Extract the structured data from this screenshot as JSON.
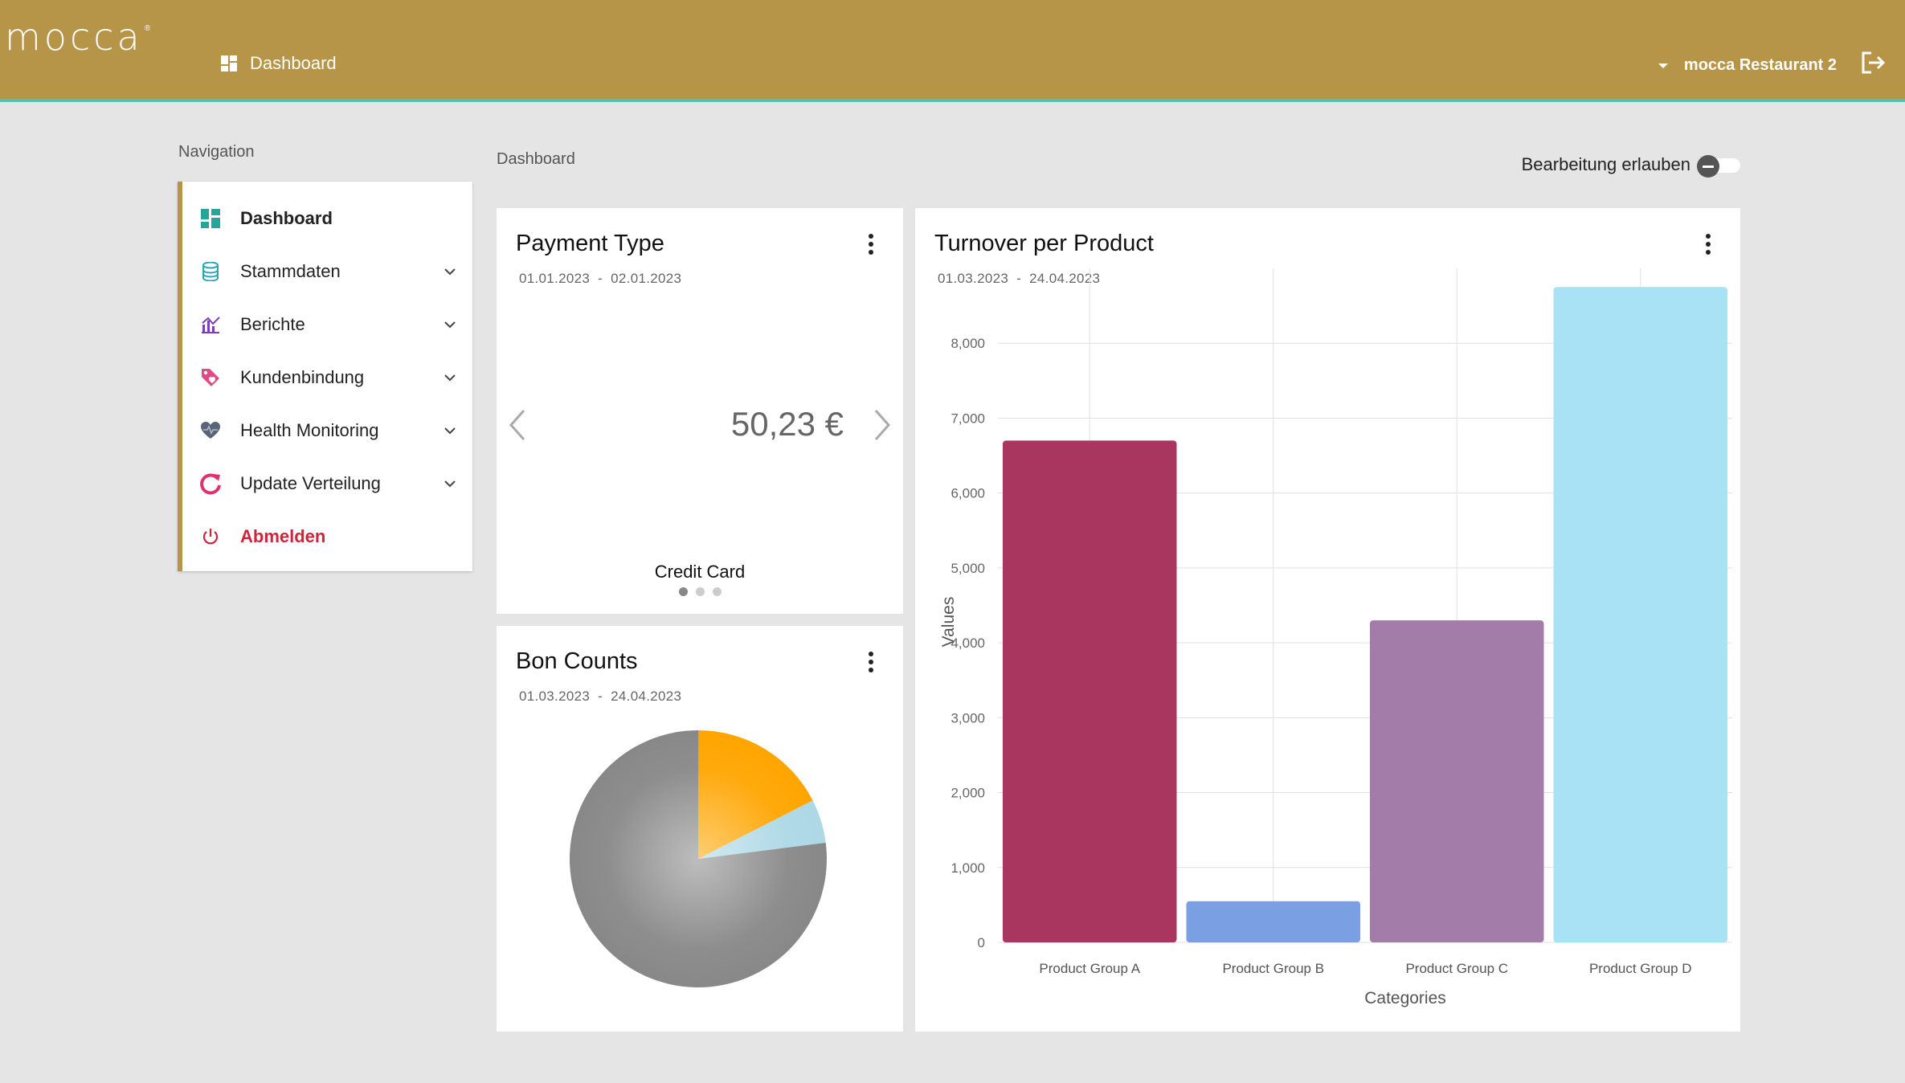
{
  "app": {
    "logo_text": "mocca",
    "logo_mark": "®"
  },
  "topbar": {
    "page_label": "Dashboard",
    "user_label": "mocca Restaurant 2"
  },
  "navigation": {
    "heading": "Navigation",
    "items": [
      {
        "label": "Dashboard",
        "icon": "dashboard-icon",
        "color": "#26a69a",
        "active": true,
        "expandable": false
      },
      {
        "label": "Stammdaten",
        "icon": "database-icon",
        "color": "#26a6b7",
        "active": false,
        "expandable": true
      },
      {
        "label": "Berichte",
        "icon": "chart-icon",
        "color": "#7b3fb5",
        "active": false,
        "expandable": true
      },
      {
        "label": "Kundenbindung",
        "icon": "tag-icon",
        "color": "#e04a86",
        "active": false,
        "expandable": true
      },
      {
        "label": "Health Monitoring",
        "icon": "heart-icon",
        "color": "#5a6478",
        "active": false,
        "expandable": true
      },
      {
        "label": "Update Verteilung",
        "icon": "refresh-icon",
        "color": "#e0306e",
        "active": false,
        "expandable": true
      },
      {
        "label": "Abmelden",
        "icon": "power-icon",
        "color": "#d0233c",
        "active": false,
        "expandable": false
      }
    ]
  },
  "page": {
    "title": "Dashboard",
    "edit_toggle_label": "Bearbeitung erlauben",
    "edit_toggle_on": false
  },
  "payment_card": {
    "title": "Payment Type",
    "date_from": "01.01.2023",
    "date_to": "02.01.2023",
    "value": "50,23 €",
    "label": "Credit Card",
    "slides": 3,
    "active_slide": 0
  },
  "bon_card": {
    "title": "Bon Counts",
    "date_from": "01.03.2023",
    "date_to": "24.04.2023"
  },
  "turnover_card": {
    "title": "Turnover per Product",
    "date_from": "01.03.2023",
    "date_to": "24.04.2023"
  },
  "chart_data": [
    {
      "type": "pie",
      "slices": [
        {
          "value": 17.5,
          "color": "#ffa500"
        },
        {
          "value": 5.5,
          "color": "#add8e6"
        },
        {
          "value": 77,
          "color": "#888888"
        }
      ]
    },
    {
      "type": "bar",
      "categories": [
        "Product Group A",
        "Product Group B",
        "Product Group C",
        "Product Group D"
      ],
      "values": [
        6700,
        550,
        4300,
        8750
      ],
      "colors": [
        "#a8365e",
        "#7a9fe2",
        "#a37caa",
        "#a8e2f4"
      ],
      "xlabel": "Categories",
      "ylabel": "Values",
      "ylim": [
        0,
        9000
      ],
      "yticks": [
        0,
        1000,
        2000,
        3000,
        4000,
        5000,
        6000,
        7000,
        8000
      ],
      "ytick_labels": [
        "0",
        "1,000",
        "2,000",
        "3,000",
        "4,000",
        "5,000",
        "6,000",
        "7,000",
        "8,000"
      ],
      "grid": true
    }
  ]
}
